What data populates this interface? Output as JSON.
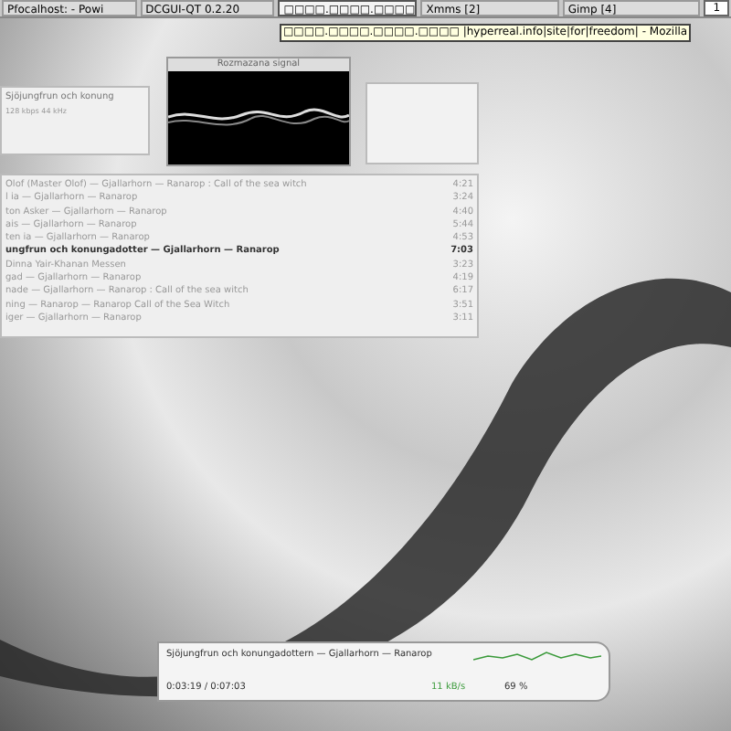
{
  "taskbar": {
    "tasks": [
      {
        "label": "Pfocalhost: - Powi",
        "selected": false
      },
      {
        "label": "DCGUI-QT 0.2.20",
        "selected": false
      },
      {
        "label": "□□□□.□□□□.□□□□",
        "selected": true
      },
      {
        "label": "Xmms [2]",
        "selected": false
      },
      {
        "label": "Gimp [4]",
        "selected": false
      }
    ],
    "desktop": "1"
  },
  "tooltip": "□□□□.□□□□.□□□□.□□□□ |hyperreal.info|site|for|freedom| - Mozilla",
  "player": {
    "title": "Sjöjungfrun och konung",
    "info": "128 kbps 44 kHz"
  },
  "visualizer": {
    "title": "Rozmazana signal"
  },
  "playlist": {
    "rows": [
      {
        "title": "Olof (Master Olof) — Gjallarhorn — Ranarop : Call of the sea witch",
        "time": "4:21",
        "selected": false
      },
      {
        "title": "l ia — Gjallarhorn — Ranarop",
        "time": "3:24",
        "selected": false
      },
      {
        "title": "ton Asker — Gjallarhorn — Ranarop",
        "time": "4:40",
        "selected": false
      },
      {
        "title": "ais — Gjallarhorn — Ranarop",
        "time": "5:44",
        "selected": false
      },
      {
        "title": "ten ia — Gjallarhorn — Ranarop",
        "time": "4:53",
        "selected": false
      },
      {
        "title": "ungfrun och konungadotter — Gjallarhorn — Ranarop",
        "time": "7:03",
        "selected": true
      },
      {
        "title": "Dinna Yair-Khanan Messen",
        "time": "3:23",
        "selected": false
      },
      {
        "title": "gad — Gjallarhorn — Ranarop",
        "time": "4:19",
        "selected": false
      },
      {
        "title": "nade — Gjallarhorn — Ranarop : Call of the sea witch",
        "time": "6:17",
        "selected": false
      },
      {
        "title": "ning — Ranarop — Ranarop Call of the Sea Witch",
        "time": "3:51",
        "selected": false
      },
      {
        "title": "iger — Gjallarhorn — Ranarop",
        "time": "3:11",
        "selected": false
      }
    ]
  },
  "osd": {
    "track": "Sjöjungfrun och konungadottern — Gjallarhorn — Ranarop",
    "position": "0:03:19 / 0:07:03",
    "rate": "11 kB/s",
    "volume": "69 %"
  }
}
